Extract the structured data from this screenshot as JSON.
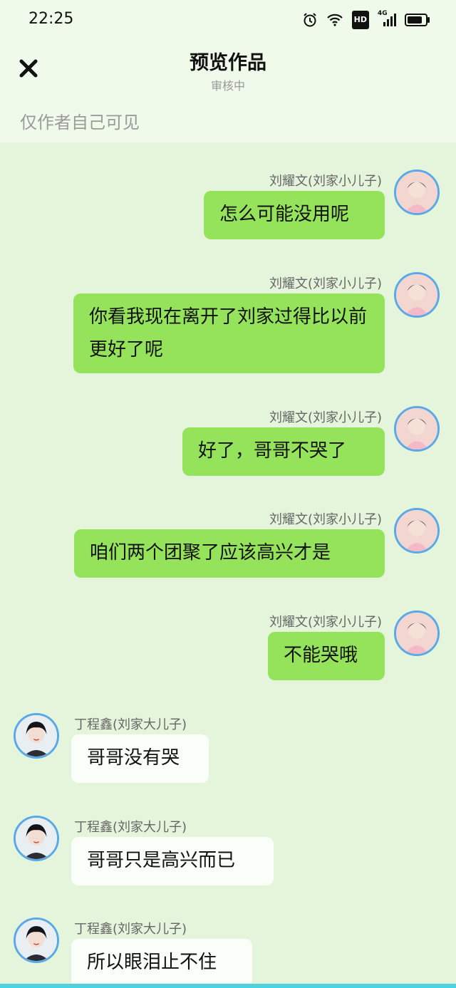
{
  "status_bar": {
    "time": "22:25",
    "hd_label": "HD",
    "network_label": "4G"
  },
  "header": {
    "title": "预览作品",
    "subtitle": "审核中",
    "visibility_note": "仅作者自己可见"
  },
  "messages": [
    {
      "side": "right",
      "sender": "刘耀文(刘家小儿子)",
      "text": "怎么可能没用呢"
    },
    {
      "side": "right",
      "sender": "刘耀文(刘家小儿子)",
      "text": "你看我现在离开了刘家过得比以前更好了呢"
    },
    {
      "side": "right",
      "sender": "刘耀文(刘家小儿子)",
      "text": "好了，哥哥不哭了"
    },
    {
      "side": "right",
      "sender": "刘耀文(刘家小儿子)",
      "text": "咱们两个团聚了应该高兴才是"
    },
    {
      "side": "right",
      "sender": "刘耀文(刘家小儿子)",
      "text": "不能哭哦"
    },
    {
      "side": "left",
      "sender": "丁程鑫(刘家大儿子)",
      "text": "哥哥没有哭"
    },
    {
      "side": "left",
      "sender": "丁程鑫(刘家大儿子)",
      "text": "哥哥只是高兴而已"
    },
    {
      "side": "left",
      "sender": "丁程鑫(刘家大儿子)",
      "text": "所以眼泪止不住"
    }
  ],
  "colors": {
    "background": "#e4f5db",
    "outgoing_bubble": "#95e35a",
    "incoming_bubble": "#fafdf8",
    "avatar_border": "#5aa9e6"
  }
}
